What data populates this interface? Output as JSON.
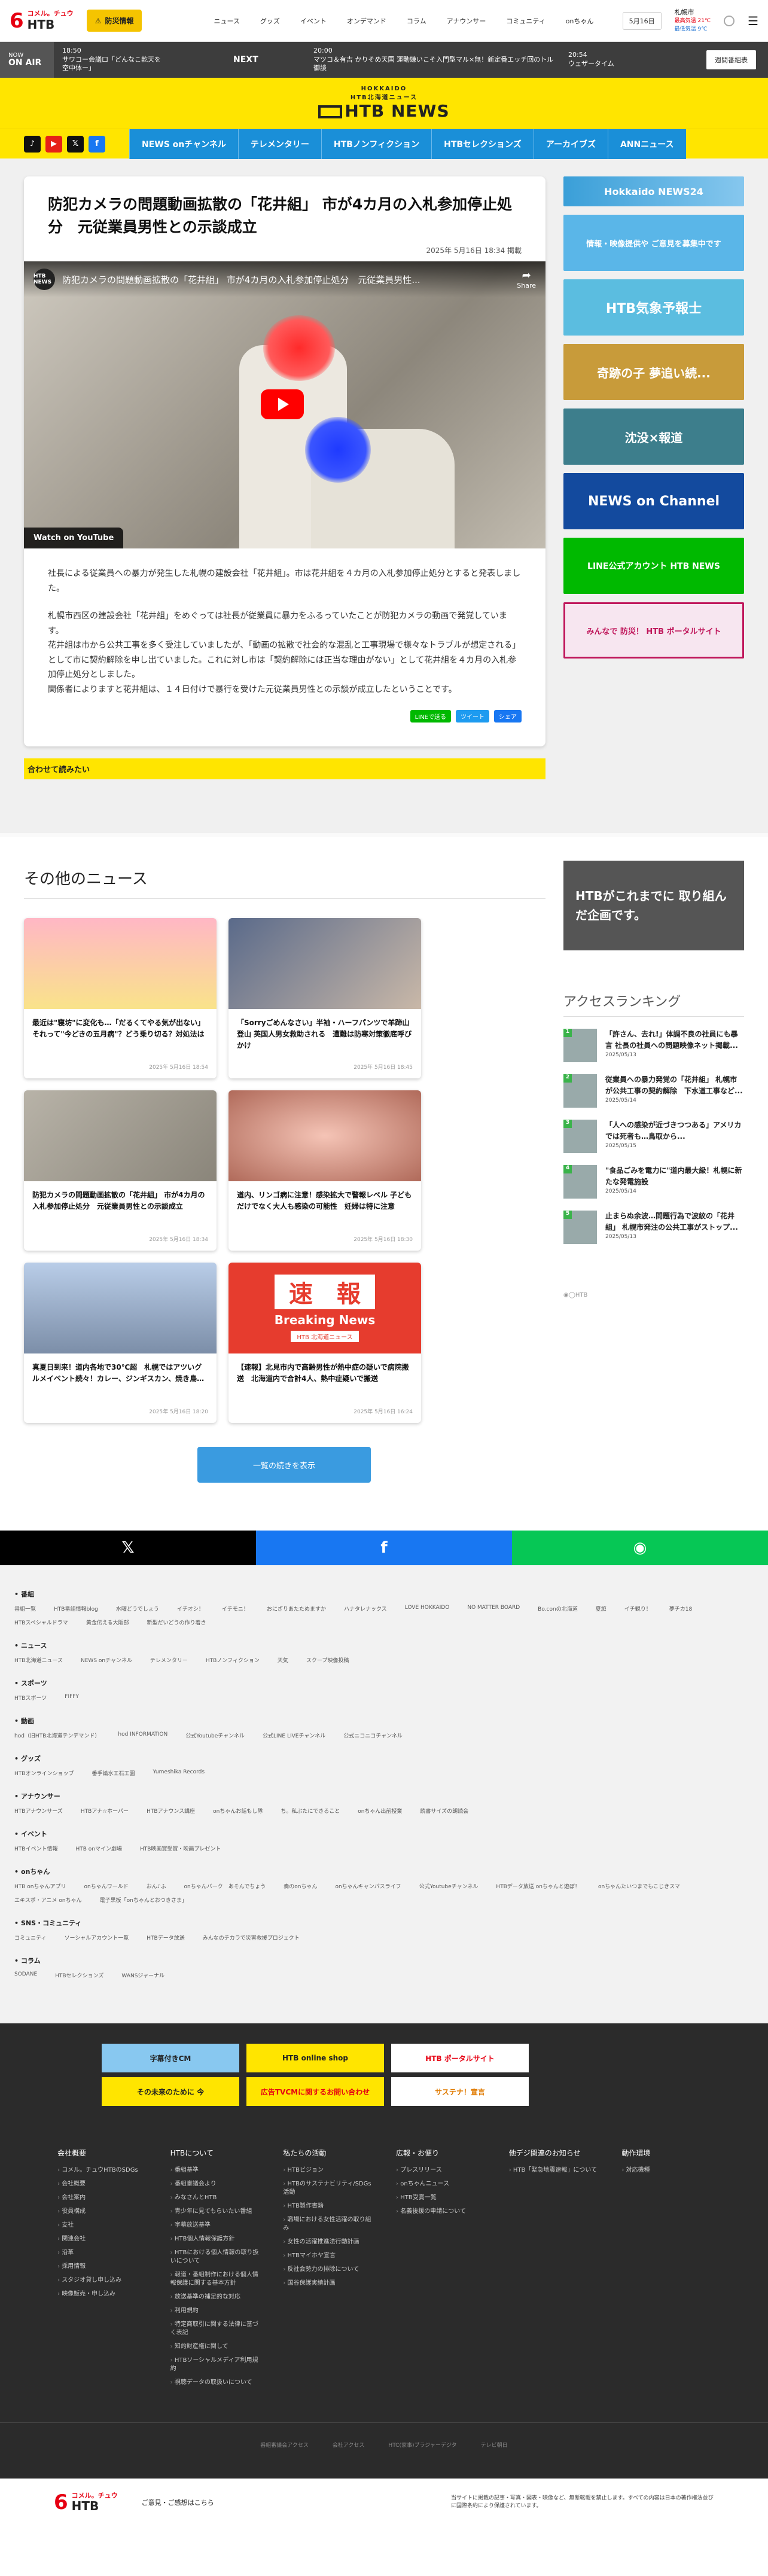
{
  "header": {
    "logo_num": "6",
    "logo_small": "コメル。チュウ",
    "logo_main": "HTB",
    "bosai": "防災情報",
    "nav": [
      "ニュース",
      "グッズ",
      "イベント",
      "オンデマンド",
      "コラム",
      "アナウンサー",
      "コミュニティ",
      "onちゃん"
    ],
    "date": "5月16日",
    "weather_city": "札幌市",
    "weather_hi": "最高気温 21℃",
    "weather_lo": "最低気温 9℃",
    "menu": "MENU"
  },
  "onair": {
    "label": "NOW",
    "label2": "ON AIR",
    "now_time": "18:50",
    "now_title": "サワコー会議口「どんなこ乾天を空中体ー」",
    "next": "NEXT",
    "next_time": "20:00",
    "next_title": "マツコ＆有吉 かりそめ天国 運動嫌いこそ入門型マル×無！新定番エッチ回のトル御談",
    "later_time": "20:54",
    "later_title": "ウェザータイム",
    "btn": "週間番組表"
  },
  "hero": {
    "top": "HOKKAIDO",
    "sub": "HTB北海道ニュース",
    "main": "HTB NEWS"
  },
  "nav": {
    "links": [
      "NEWS onチャンネル",
      "テレメンタリー",
      "HTBノンフィクション",
      "HTBセレクションズ",
      "アーカイブズ",
      "ANNニュース"
    ]
  },
  "article": {
    "title": "防犯カメラの問題動画拡散の「花井組」 市が4カ月の入札参加停止処分　元従業員男性との示談成立",
    "date": "2025年 5月16日 18:34 掲載",
    "video_title": "防犯カメラの問題動画拡散の「花井組」 市が4カ月の入札参加停止処分　元従業員男性...",
    "channel": "HTB NEWS",
    "share": "Share",
    "watch": "Watch on  YouTube",
    "p1": "社長による従業員への暴力が発生した札幌の建設会社「花井組」。市は花井組を４カ月の入札参加停止処分とすると発表しました。",
    "p2": "札幌市西区の建設会社「花井組」をめぐっては社長が従業員に暴力をふるっていたことが防犯カメラの動画で発覚しています。\n花井組は市から公共工事を多く受注していましたが、「動画の拡散で社会的な混乱と工事現場で様々なトラブルが想定される」として市に契約解除を申し出ていました。これに対し市は「契約解除には正当な理由がない」として花井組を４カ月の入札参加停止処分としました。\n関係者によりますと花井組は、１４日付けで暴行を受けた元従業員男性との示談が成立したということです。",
    "line": "LINEで送る",
    "tweet": "ツイート",
    "fb": "シェア",
    "related": "合わせて読みたい"
  },
  "sidebar": {
    "banners": [
      "Hokkaido NEWS24",
      "情報・映像提供や ご意見を募集中です",
      "HTB気象予報士",
      "奇跡の子 夢追い続...",
      "沈没×報道",
      "NEWS on Channel",
      "LINE公式アカウント HTB NEWS",
      "みんなで 防災！ HTB ポータルサイト"
    ]
  },
  "other": {
    "title": "その他のニュース",
    "cards": [
      {
        "title": "最近は\"寝坊\"に変化も…「だるくてやる気が出ない」それって\"今どきの五月病\"？どう乗り切る？対処法は",
        "date": "2025年 5月16日 18:54"
      },
      {
        "title": "「Sorryごめんなさい」半袖・ハーフパンツで羊蹄山登山 英国人男女救助される　遭難は防寒対策徹底呼びかけ",
        "date": "2025年 5月16日 18:45"
      },
      {
        "title": "防犯カメラの問題動画拡散の「花井組」 市が4カ月の入札参加停止処分　元従業員男性との示談成立",
        "date": "2025年 5月16日 18:34"
      },
      {
        "title": "道内、リンゴ病に注意！感染拡大で警報レベル 子どもだけでなく大人も感染の可能性　妊婦は特に注意",
        "date": "2025年 5月16日 18:30"
      },
      {
        "title": "真夏日到来！道内各地で30℃超　札幌ではアツいグルメイベント続々！カレー、ジンギスカン、焼き鳥…",
        "date": "2025年 5月16日 18:20"
      },
      {
        "title": "【速報】北見市内で高齢男性が熱中症の疑いで病院搬送　北海道内で合計4人、熱中症疑いで搬送",
        "date": "2025年 5月16日 16:24"
      }
    ],
    "breaking": "速　報",
    "breaking_en": "Breaking News",
    "breaking_sub": "HTB 北海道ニュース",
    "more": "一覧の続きを表示",
    "banner": "HTBがこれまでに 取り組んだ企画です。",
    "rank_title": "アクセスランキング",
    "ranks": [
      {
        "n": "1",
        "title": "「許さん、去れ!」体調不良の社員にも暴言 社長の社員への問題映像ネット掲載...",
        "date": "2025/05/13"
      },
      {
        "n": "2",
        "title": "従業員への暴力発覚の「花井組」 札幌市が公共工事の契約解除　下水道工事など...",
        "date": "2025/05/14"
      },
      {
        "n": "3",
        "title": "「人への感染が近づきつつある」アメリカでは死者も…鳥取から...",
        "date": "2025/05/15"
      },
      {
        "n": "4",
        "title": "\"食品ごみを電力に\"道内最大級！札幌に新たな発電施設",
        "date": "2025/05/14"
      },
      {
        "n": "5",
        "title": "止まらぬ余波…問題行為で波紋の「花井組」 札幌市発注の公共工事がストップ...",
        "date": "2025/05/13"
      }
    ],
    "embed": "◉◯HTB"
  },
  "sharebar": {
    "x": "𝕏",
    "fb": "f",
    "line": "◉"
  },
  "sitemap": [
    {
      "h": "番組",
      "links": [
        "番組一覧",
        "HTB番組情報blog",
        "水曜どうでしょう",
        "イチオシ！",
        "イチモニ！",
        "おにぎりあたためますか",
        "ハナタレナックス",
        "LOVE HOKKAIDO",
        "NO MATTER BOARD",
        "Bo.conの北海道",
        "夏旅",
        "イチ観り！",
        "夢チカ18",
        "HTBスペシャルドラマ",
        "黄金伝える大阪部",
        "新型だいどうの作り着き"
      ]
    },
    {
      "h": "ニュース",
      "links": [
        "HTB北海道ニュース",
        "NEWS onチャンネル",
        "テレメンタリー",
        "HTBノンフィクション",
        "天気",
        "スクープ映像投稿"
      ]
    },
    {
      "h": "スポーツ",
      "links": [
        "HTBスポーツ",
        "FIFFY"
      ]
    },
    {
      "h": "動画",
      "links": [
        "hod（旧HTB北海道テンデマンド）",
        "hod INFORMATION",
        "公式Youtubeチャンネル",
        "公式LINE LIVEチャンネル",
        "公式ニコニコチャンネル"
      ]
    },
    {
      "h": "グッズ",
      "links": [
        "HTBオンラインショップ",
        "番手論水工石工園",
        "Yumeshika Records"
      ]
    },
    {
      "h": "アナウンサー",
      "links": [
        "HTBアナウンサーズ",
        "HTBアナ☆ホーパー",
        "HTBアナウンス講座",
        "onちゃんお話もし隊",
        "ち。私ぶたにできること",
        "onちゃん出前授業",
        "読書サイズの朗読会"
      ]
    },
    {
      "h": "イベント",
      "links": [
        "HTBイベント情報",
        "HTB onマイン劇場",
        "HTB映画賞受賞・映画プレゼント"
      ]
    },
    {
      "h": "onちゃん",
      "links": [
        "HTB onちゃんアプリ",
        "onちゃんワールド",
        "おん♪ふ",
        "onちゃんバーク　あそんでちょう",
        "奏のonちゃん",
        "onちゃんキャンパスライフ",
        "公式Youtubeチャンネル",
        "HTBデータ放送 onちゃんと遊ぼ！",
        "onちゃんたいつまでもこじきスマ",
        "エキスポ・アニメ onちゃん",
        "電子黒板「onちゃんとおつきさま」"
      ]
    },
    {
      "h": "SNS・コミュニティ",
      "links": [
        "コミュニティ",
        "ソーシャルアカウント一覧",
        "HTBデータ放送",
        "みんなのチカラで災害救援プロジェクト"
      ]
    },
    {
      "h": "コラム",
      "links": [
        "SODANE",
        "HTBセレクションズ",
        "WANSジャーナル"
      ]
    }
  ],
  "footer": {
    "banners": [
      "字幕付きCM",
      "HTB online shop",
      "HTB ポータルサイト",
      "サステナ！宣言",
      "その未来のために 今",
      "広告TVCMに関するお問い合わせ"
    ],
    "cols": [
      {
        "h": "会社概要",
        "items": [
          "コメル。チュウHTBのSDGs",
          "会社概要",
          "会社案内",
          "役員構成",
          "支社",
          "関連会社",
          "沿革",
          "採用情報",
          "スタジオ貸し申し込み",
          "映像販売・申し込み"
        ]
      },
      {
        "h": "HTBについて",
        "items": [
          "番組基準",
          "番組審議会より",
          "みなさんとHTB",
          "青少年に見てもらいたい番組",
          "字幕放送基準",
          "HTB個人情報保護方針",
          "HTBにおける個人情報の取り扱いについて",
          "報道・番組制作における個人情報保護に関する基本方針",
          "放送基準の補足的な対応",
          "利用規約",
          "特定商取引に関する法律に基づく表記",
          "知的財産権に関して",
          "HTBソーシャルメディア利用規約",
          "視聴データの取扱いについて"
        ]
      },
      {
        "h": "私たちの活動",
        "items": [
          "HTBビジョン",
          "HTBのサステナビリティ/SDGs活動",
          "HTB製作書籍",
          "職場における女性活躍の取り組み",
          "女性の活躍推進法行動計画",
          "HTBマイホヤ宣言",
          "反社会勢力の排除について",
          "国谷保護実績計画"
        ]
      },
      {
        "h": "広報・お便り",
        "items": [
          "プレスリリース",
          "onちゃんニュース",
          "HTB受賞一覧",
          "名義後援の申請について"
        ]
      },
      {
        "h": "他デジ関連のお知らせ",
        "items": [
          "HTB「緊急地震速報」について"
        ]
      },
      {
        "h": "動作環境",
        "items": [
          "対応機種"
        ]
      }
    ],
    "bottom": [
      "番組審議会アクセス",
      "会社アクセス",
      "HTC(家事)ブラジャーデジタ",
      "テレビ朝日"
    ],
    "final_link": "ご意見・ご感想はこちら",
    "copy": "当サイトに掲載の記事・写真・図表・映像など、無断転載を禁止します。すべての内容は日本の著作権法並びに国際条約により保護されています。"
  }
}
